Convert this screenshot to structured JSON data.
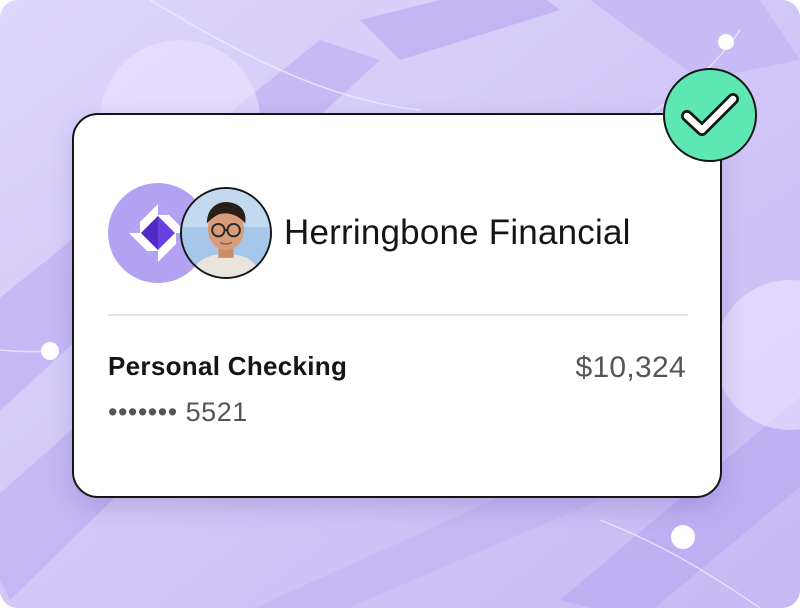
{
  "account_card": {
    "institution_name": "Herringbone Financial",
    "account_name": "Personal Checking",
    "account_mask": "••••••• 5521",
    "balance": "$10,324",
    "status_icon": "check-icon",
    "logo_icon": "herringbone-logo-icon",
    "avatar_icon": "user-avatar"
  },
  "colors": {
    "background": "#d2c8f6",
    "card": "#ffffff",
    "check_badge": "#5de8b3",
    "logo_circle": "#b3a2f2",
    "logo_accent": "#6a3fe0",
    "text_primary": "#151515",
    "text_secondary": "#555555"
  }
}
